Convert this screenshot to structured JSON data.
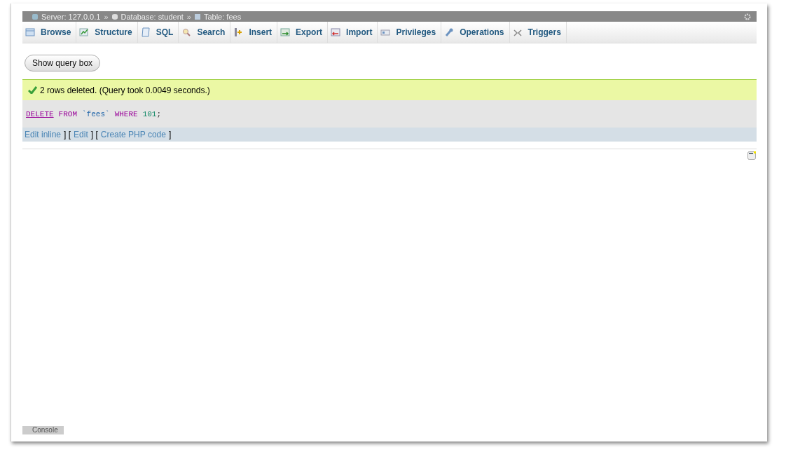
{
  "breadcrumb": [
    {
      "label": "Server: 127.0.0.1"
    },
    {
      "label": "Database: student"
    },
    {
      "label": "Table: fees"
    }
  ],
  "breadcrumb_separator": "»",
  "tabs": [
    {
      "label": "Browse",
      "selected": false
    },
    {
      "label": "Structure",
      "selected": false
    },
    {
      "label": "SQL",
      "selected": false
    },
    {
      "label": "Search",
      "selected": false
    },
    {
      "label": "Insert",
      "selected": false
    },
    {
      "label": "Export",
      "selected": false
    },
    {
      "label": "Import",
      "selected": false
    },
    {
      "label": "Privileges",
      "selected": false
    },
    {
      "label": "Operations",
      "selected": false
    },
    {
      "label": "Triggers",
      "selected": false
    }
  ],
  "show_query_button": "Show query box",
  "message": "2 rows deleted. (Query took 0.0049 seconds.)",
  "query": [
    {
      "text": "DELETE",
      "kind": "keyword-link"
    },
    {
      "text": "FROM",
      "kind": "keyword"
    },
    {
      "text": "`fees`",
      "kind": "identifier"
    },
    {
      "text": "WHERE",
      "kind": "keyword"
    },
    {
      "text": "101",
      "kind": "number"
    },
    {
      "text": ";",
      "kind": "punct"
    }
  ],
  "query_links": [
    {
      "label": "Edit inline"
    },
    {
      "label": "Edit"
    },
    {
      "label": "Create PHP code"
    }
  ],
  "link_separator": "] [",
  "link_end": "]",
  "console_tab": "Console"
}
